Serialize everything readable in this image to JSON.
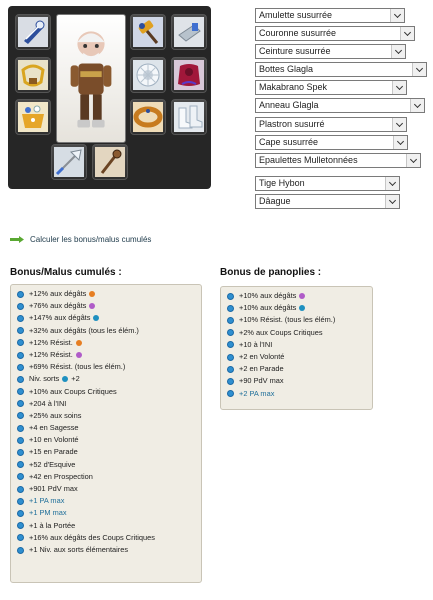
{
  "equipment": {
    "slots": [
      {
        "name": "slot-amulet",
        "icon": "amulet-icon"
      },
      {
        "name": "slot-dofus-a",
        "icon": "hammer-icon"
      },
      {
        "name": "slot-dofus-b",
        "icon": "gauntlet-icon"
      },
      {
        "name": "slot-belt",
        "icon": "belt-icon"
      },
      {
        "name": "slot-hat",
        "icon": "snow-hat-icon"
      },
      {
        "name": "slot-cape",
        "icon": "red-cape-icon"
      },
      {
        "name": "slot-ring",
        "icon": "ring-icon"
      },
      {
        "name": "slot-bracelet",
        "icon": "bracelet-icon"
      },
      {
        "name": "slot-boots",
        "icon": "boots-icon"
      },
      {
        "name": "slot-weapon",
        "icon": "axe-icon"
      },
      {
        "name": "slot-pet",
        "icon": "staff-icon"
      }
    ]
  },
  "selects": [
    "Amulette susurrée",
    "Couronne susurrée",
    "Ceinture susurrée",
    "Bottes Glagla",
    "Makabrano Spek",
    "Anneau Glagla",
    "Plastron susurré",
    "Cape susurrée",
    "Epaulettes Mulletonnées",
    "Tige Hybon",
    "Dâague"
  ],
  "calc_link": "Calculer les bonus/malus cumulés",
  "cumulative": {
    "title": "Bonus/Malus cumulés :",
    "rows": [
      {
        "text": "+12% aux dégâts",
        "icon": "fire-icon",
        "color": "#e67e22"
      },
      {
        "text": "+76% aux dégâts",
        "icon": "air-icon",
        "color": "#b05cc8"
      },
      {
        "text": "+147% aux dégâts",
        "icon": "water-icon",
        "color": "#1e90c0"
      },
      {
        "text": "+32% aux dégâts (tous les élém.)"
      },
      {
        "text": "+12% Résist.",
        "icon": "fire-icon",
        "color": "#e67e22"
      },
      {
        "text": "+12% Résist.",
        "icon": "air-icon",
        "color": "#b05cc8"
      },
      {
        "text": "+69% Résist. (tous les élém.)"
      },
      {
        "text": "Niv. sorts",
        "icon": "water-icon",
        "color": "#1e90c0",
        "suffix": "+2"
      },
      {
        "text": "+10% aux Coups Critiques"
      },
      {
        "text": "+204 à l'INI"
      },
      {
        "text": "+25% aux soins"
      },
      {
        "text": "+4 en Sagesse"
      },
      {
        "text": "+10 en Volonté"
      },
      {
        "text": "+15 en Parade"
      },
      {
        "text": "+52 d'Esquive"
      },
      {
        "text": "+42 en Prospection"
      },
      {
        "text": "+901 PdV max"
      },
      {
        "text": "+1 PA max",
        "highlight": true
      },
      {
        "text": "+1 PM max",
        "highlight": true
      },
      {
        "text": "+1 à la Portée"
      },
      {
        "text": "+16% aux dégâts des Coups Critiques"
      },
      {
        "text": "+1 Niv. aux sorts élémentaires"
      }
    ]
  },
  "panoplies": {
    "title": "Bonus de panoplies :",
    "rows": [
      {
        "text": "+10% aux dégâts",
        "icon": "air-icon",
        "color": "#b05cc8"
      },
      {
        "text": "+10% aux dégâts",
        "icon": "water-icon",
        "color": "#1e90c0"
      },
      {
        "text": "+10% Résist. (tous les élém.)"
      },
      {
        "text": "+2% aux Coups Critiques"
      },
      {
        "text": "+10 à l'INI"
      },
      {
        "text": "+2 en Volonté"
      },
      {
        "text": "+2 en Parade"
      },
      {
        "text": "+90 PdV max"
      },
      {
        "text": "+2 PA max",
        "highlight": true
      }
    ]
  }
}
